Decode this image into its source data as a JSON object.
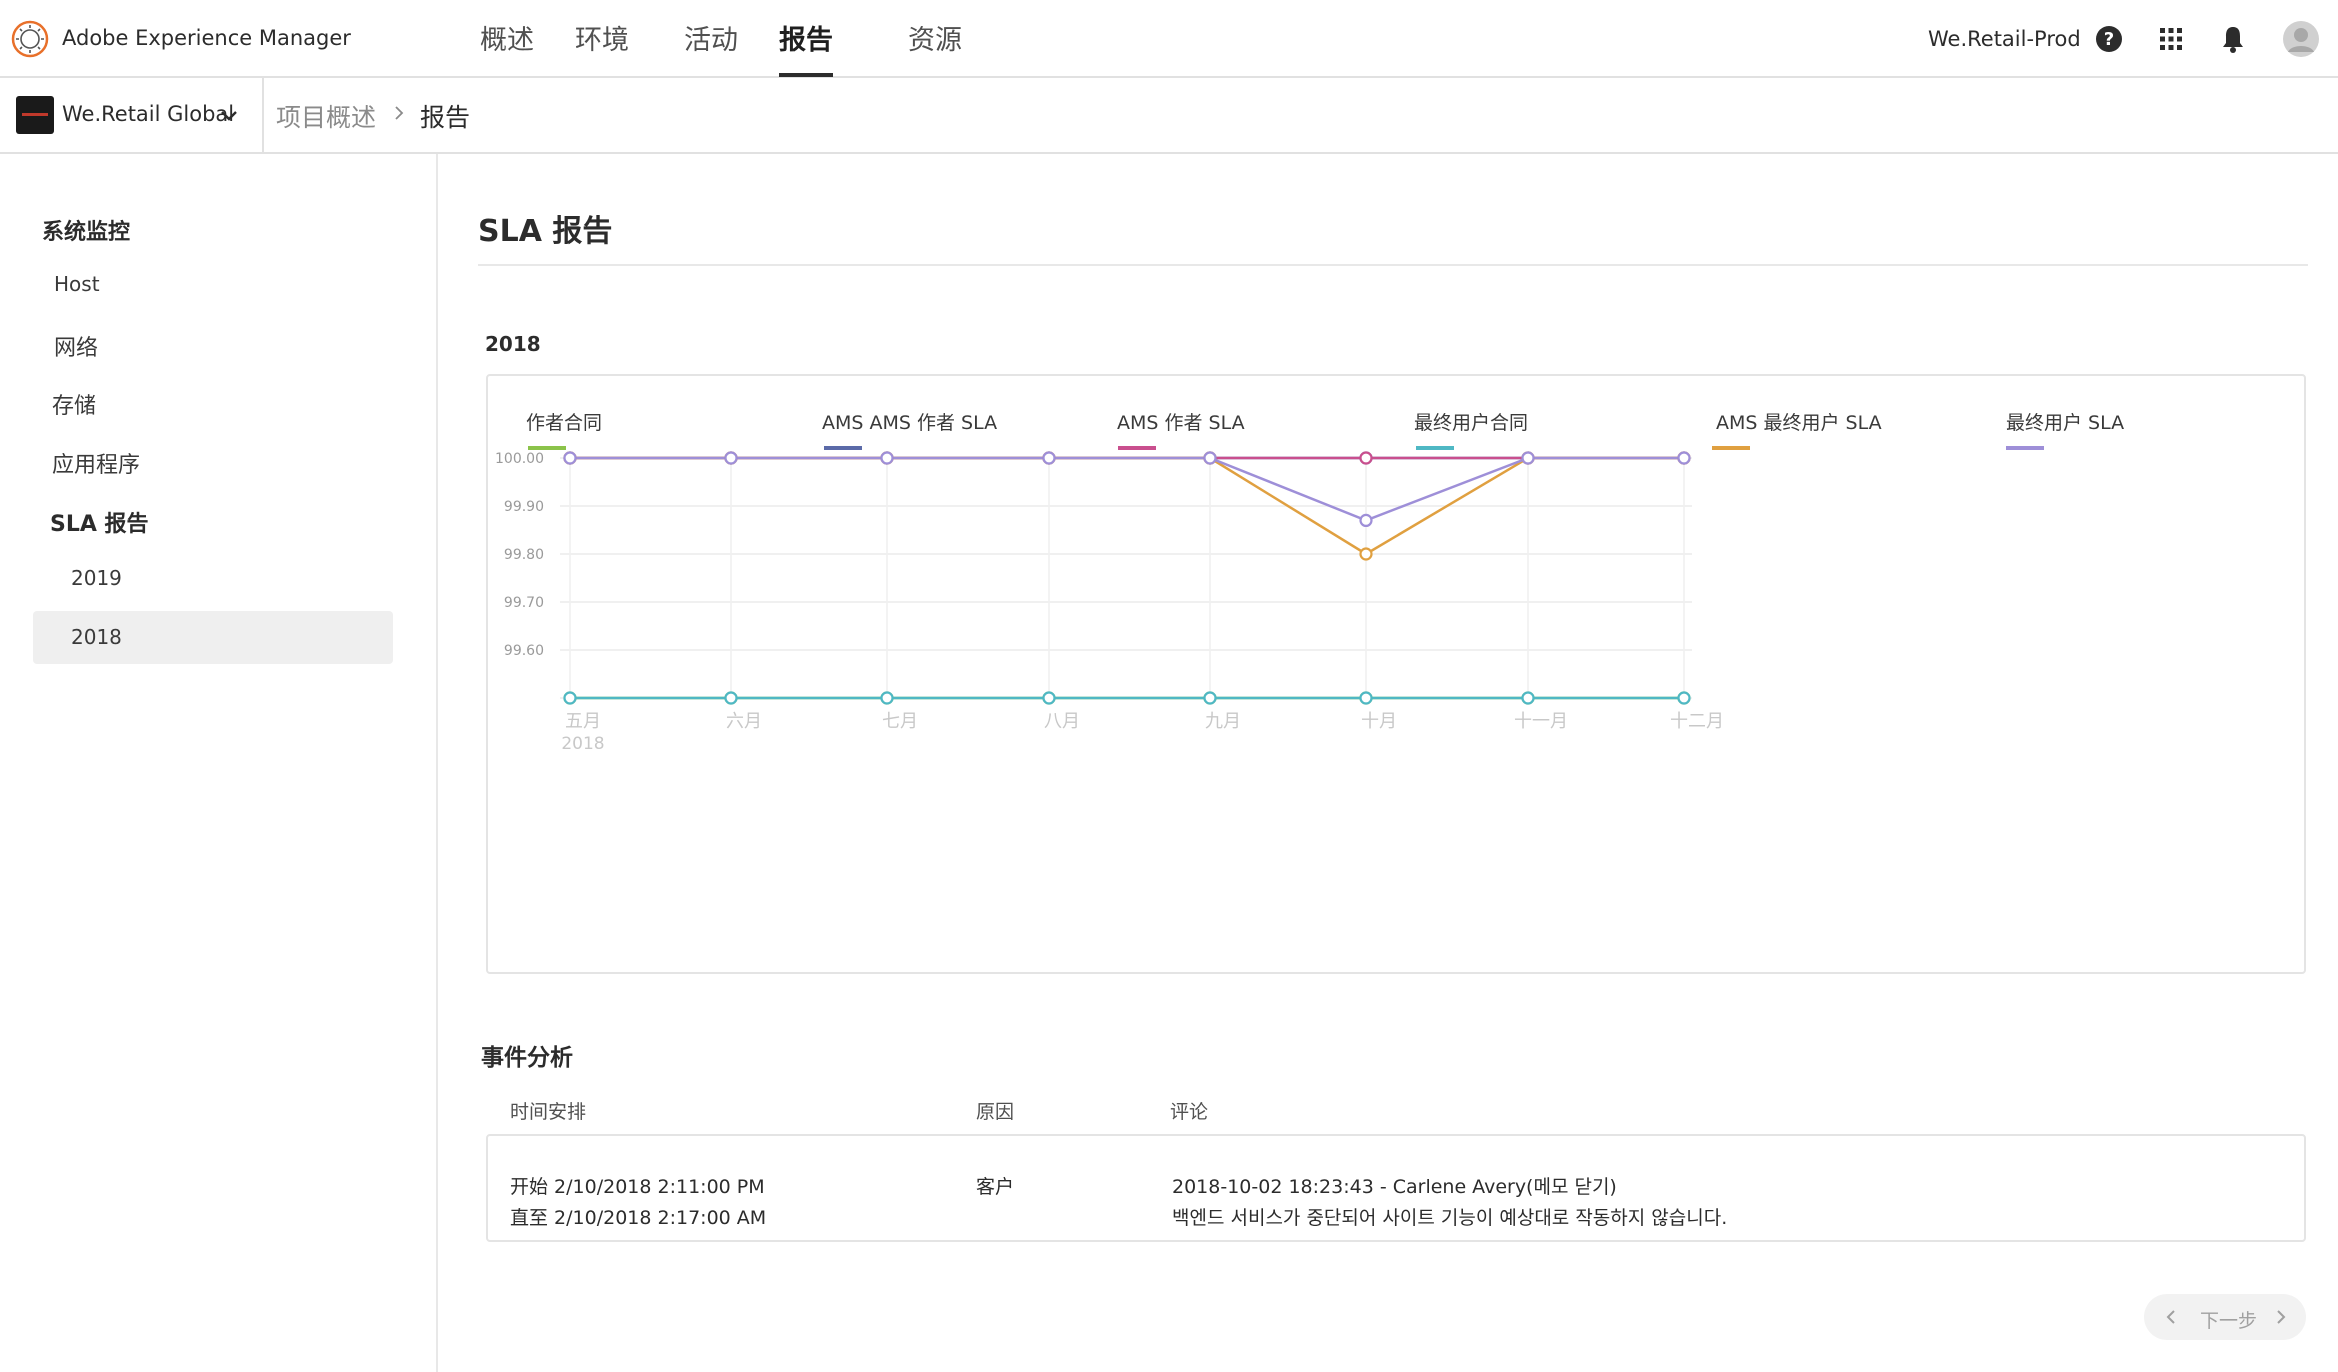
{
  "header": {
    "app_title": "Adobe Experience Manager",
    "nav_tabs": [
      {
        "label": "概述",
        "active": false
      },
      {
        "label": "环境",
        "active": false
      },
      {
        "label": "活动",
        "active": false
      },
      {
        "label": "报告",
        "active": true
      },
      {
        "label": "资源",
        "active": false
      }
    ],
    "org_name": "We.Retail-Prod",
    "icons": [
      "help-icon",
      "apps-grid-icon",
      "bell-icon",
      "avatar"
    ]
  },
  "subheader": {
    "tenant": "We.Retail Global",
    "breadcrumb": [
      "项目概述",
      "报告"
    ]
  },
  "sidebar": {
    "heading": "系统监控",
    "items": [
      {
        "label": "Host"
      },
      {
        "label": "网络"
      },
      {
        "label": "存储"
      },
      {
        "label": "应用程序"
      },
      {
        "label": "SLA 报告",
        "bold": true
      },
      {
        "label": "2019"
      },
      {
        "label": "2018",
        "selected": true
      }
    ]
  },
  "main": {
    "title": "SLA 报告",
    "year": "2018"
  },
  "colors": {
    "green": "#8bc34a",
    "navy": "#5b6aa8",
    "pink": "#c94f8e",
    "teal": "#4fb8c4",
    "orange": "#e0a040",
    "purple": "#9e8fd8",
    "accent_text": "#2c2c2c"
  },
  "chart_data": {
    "type": "line",
    "categories": [
      "五月",
      "六月",
      "七月",
      "八月",
      "九月",
      "十月",
      "十一月",
      "十二月"
    ],
    "first_category_year": "2018",
    "y_ticks": [
      "100.00",
      "99.90",
      "99.80",
      "99.70",
      "99.60"
    ],
    "ylim": [
      99.5,
      100.0
    ],
    "grid": true,
    "legend_position": "top",
    "series": [
      {
        "name": "作者合同",
        "color": "#8bc34a",
        "values": [
          99.5,
          99.5,
          99.5,
          99.5,
          99.5,
          99.5,
          99.5,
          99.5
        ]
      },
      {
        "name": "AMS AMS 作者 SLA",
        "color": "#5b6aa8",
        "values": [
          100,
          100,
          100,
          100,
          100,
          100,
          100,
          100
        ]
      },
      {
        "name": "AMS 作者 SLA",
        "color": "#c94f8e",
        "values": [
          100,
          100,
          100,
          100,
          100,
          100,
          100,
          100
        ]
      },
      {
        "name": "最终用户合同",
        "color": "#4fb8c4",
        "values": [
          99.5,
          99.5,
          99.5,
          99.5,
          99.5,
          99.5,
          99.5,
          99.5
        ]
      },
      {
        "name": "AMS 最终用户 SLA",
        "color": "#e0a040",
        "values": [
          100,
          100,
          100,
          100,
          100,
          99.8,
          100,
          100
        ]
      },
      {
        "name": "最终用户 SLA",
        "color": "#9e8fd8",
        "values": [
          100,
          100,
          100,
          100,
          100,
          99.87,
          100,
          100
        ]
      }
    ]
  },
  "incidents": {
    "title": "事件分析",
    "columns": [
      "时间安排",
      "原因",
      "评论"
    ],
    "rows": [
      {
        "start": "开始 2/10/2018  2:11:00 PM",
        "end": "直至 2/10/2018  2:17:00 AM",
        "reason": "客户",
        "comment_line1": "2018-10-02 18:23:43 - Carlene Avery(메모 닫기)",
        "comment_line2": "백엔드 서비스가 중단되어 사이트 기능이 예상대로 작동하지 않습니다."
      }
    ]
  },
  "pager": {
    "next_label": "下一步"
  }
}
